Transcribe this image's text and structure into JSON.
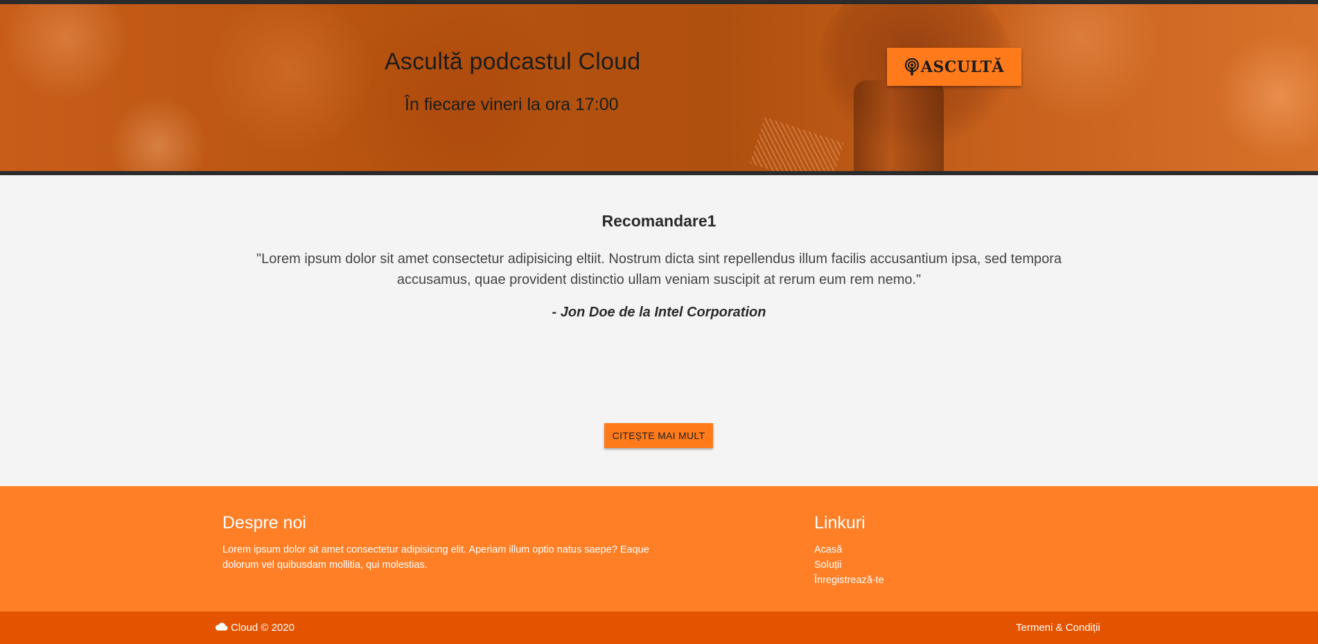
{
  "hero": {
    "title": "Ascultă podcastul Cloud",
    "subtitle": "În fiecare vineri la ora 17:00",
    "listen_button": {
      "label": "ASCULTĂ",
      "icon": "podcast-icon"
    }
  },
  "testimonial": {
    "title": "Recomandare1",
    "quote": "\"Lorem ipsum dolor sit amet consectetur adipisicing eltiit. Nostrum dicta sint repellendus illum facilis accusantium ipsa, sed tempora accusamus, quae provident distinctio ullam veniam suscipit at rerum eum rem nemo.\"",
    "author": "- Jon Doe de la Intel Corporation",
    "read_more_label": "CITEȘTE MAI MULT"
  },
  "footer": {
    "about": {
      "heading": "Despre noi",
      "text": "Lorem ipsum dolor sit amet consectetur adipisicing elit. Aperiam illum optio natus saepe? Eaque dolorum vel quibusdam mollitia, qui molestias."
    },
    "links": {
      "heading": "Linkuri",
      "items": [
        "Acasă",
        "Soluții",
        "Înregistrează-te"
      ]
    },
    "copyright": "Cloud © 2020",
    "copyright_icon": "cloud-icon",
    "terms": "Termeni & Condiții"
  },
  "colors": {
    "accent": "#ff7a1a",
    "footer": "#ff7f26",
    "bottom_bar": "#e45400",
    "hero_border": "#2b2b2b",
    "background": "#f4f4f4"
  }
}
